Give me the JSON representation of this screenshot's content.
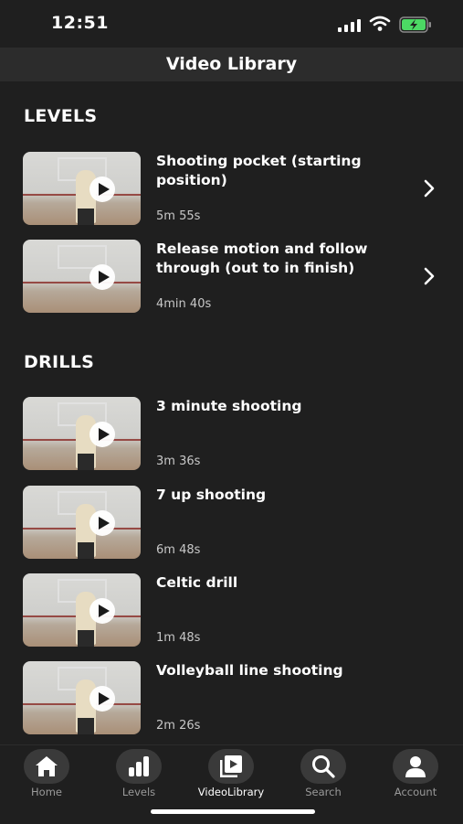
{
  "status_bar": {
    "time": "12:51"
  },
  "nav": {
    "title": "Video Library"
  },
  "sections": [
    {
      "heading": "LEVELS",
      "videos": [
        {
          "title": "Shooting pocket (starting position)",
          "duration": "5m 55s"
        },
        {
          "title": "Release motion and follow through (out to in finish)",
          "duration": "4min 40s"
        }
      ]
    },
    {
      "heading": "DRILLS",
      "videos": [
        {
          "title": "3 minute shooting",
          "duration": "3m 36s"
        },
        {
          "title": "7 up shooting",
          "duration": "6m 48s"
        },
        {
          "title": "Celtic drill",
          "duration": "1m 48s"
        },
        {
          "title": "Volleyball line shooting",
          "duration": "2m 26s"
        }
      ]
    }
  ],
  "tabs": [
    {
      "label": "Home",
      "icon": "home-icon"
    },
    {
      "label": "Levels",
      "icon": "bar-chart-icon"
    },
    {
      "label": "VideoLibrary",
      "icon": "video-library-icon",
      "active": true
    },
    {
      "label": "Search",
      "icon": "search-icon"
    },
    {
      "label": "Account",
      "icon": "account-icon"
    }
  ],
  "colors": {
    "background": "#1f1f1f",
    "nav_bar": "#2c2c2c",
    "tab_icon_bg": "#3a3a3a",
    "battery_charge": "#4cd964"
  }
}
